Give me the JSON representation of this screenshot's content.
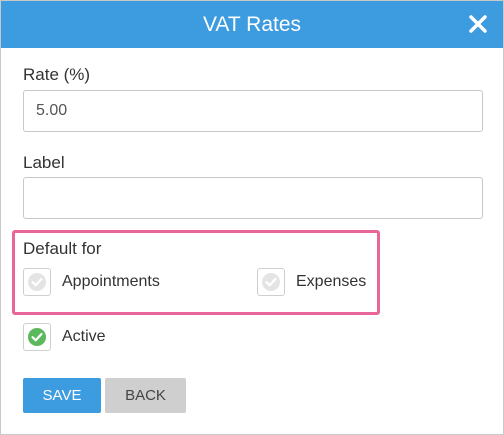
{
  "dialog": {
    "title": "VAT Rates",
    "close_icon": "close-icon"
  },
  "rate": {
    "label": "Rate (%)",
    "value": "5.00"
  },
  "label_field": {
    "label": "Label",
    "value": ""
  },
  "default_for": {
    "heading": "Default for",
    "appointments": {
      "label": "Appointments",
      "checked": false
    },
    "expenses": {
      "label": "Expenses",
      "checked": false
    }
  },
  "active": {
    "label": "Active",
    "checked": true
  },
  "buttons": {
    "save": "SAVE",
    "back": "BACK"
  },
  "colors": {
    "accent": "#3d9be0",
    "highlight": "#e8669a",
    "check_on": "#5cb85c",
    "check_off": "#d9d9d9"
  }
}
